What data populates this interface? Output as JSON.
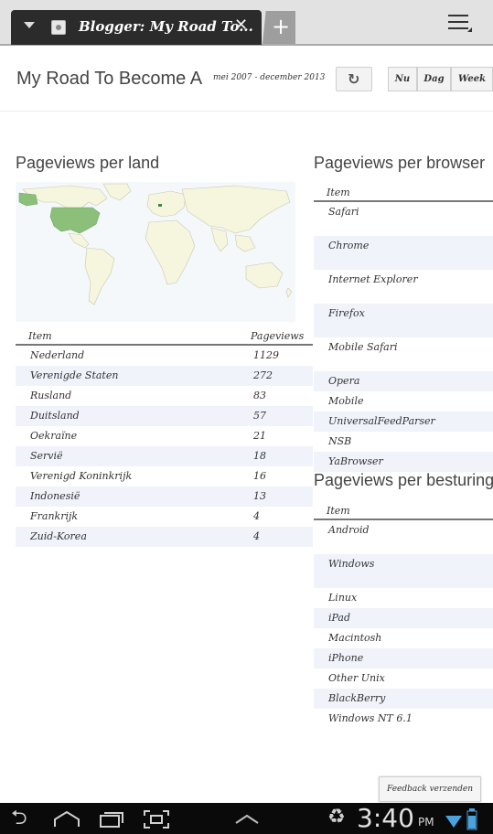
{
  "browser": {
    "tab_title": "Blogger: My Road To...",
    "close_glyph": "✕",
    "new_tab_glyph": "+"
  },
  "header": {
    "title": "My Road To Become A",
    "date_range": "mei 2007 - december 2013",
    "refresh_icon": "refresh-icon",
    "ranges": [
      "Nu",
      "Dag",
      "Week"
    ]
  },
  "country": {
    "heading": "Pageviews per land",
    "col_item": "Item",
    "col_views": "Pageviews",
    "rows": [
      {
        "name": "Nederland",
        "views": "1129"
      },
      {
        "name": "Verenigde Staten",
        "views": "272"
      },
      {
        "name": "Rusland",
        "views": "83"
      },
      {
        "name": "Duitsland",
        "views": "57"
      },
      {
        "name": "Oekraïne",
        "views": "21"
      },
      {
        "name": "Servië",
        "views": "18"
      },
      {
        "name": "Verenigd Koninkrijk",
        "views": "16"
      },
      {
        "name": "Indonesië",
        "views": "13"
      },
      {
        "name": "Frankrijk",
        "views": "4"
      },
      {
        "name": "Zuid-Korea",
        "views": "4"
      }
    ]
  },
  "browsers": {
    "heading": "Pageviews per browser",
    "col_item": "Item",
    "rows": [
      "Safari",
      "Chrome",
      "Internet Explorer",
      "Firefox",
      "Mobile Safari",
      "Opera",
      "Mobile",
      "UniversalFeedParser",
      "NSB",
      "YaBrowser"
    ]
  },
  "os": {
    "heading": "Pageviews per besturing",
    "col_item": "Item",
    "rows": [
      "Android",
      "Windows",
      "Linux",
      "iPad",
      "Macintosh",
      "iPhone",
      "Other Unix",
      "BlackBerry",
      "Windows NT 6.1"
    ]
  },
  "feedback": "Feedback verzenden",
  "system": {
    "time": "3:40",
    "ampm": "PM"
  },
  "colors": {
    "map_highlight": "#8cc07a",
    "map_land": "#f6f6df",
    "alt_row": "#f1f3fb"
  }
}
